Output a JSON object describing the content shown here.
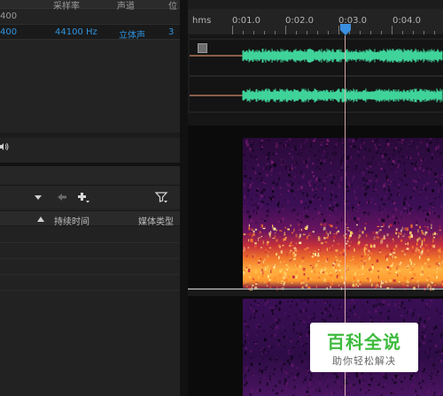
{
  "files_panel": {
    "columns": [
      {
        "label": "采样率"
      },
      {
        "label": "声道"
      },
      {
        "label": "位"
      }
    ],
    "partial_row_value": "400",
    "selected_file": {
      "duration": "400",
      "sample_rate": "44100 Hz",
      "channels": "立体声",
      "bit": "3"
    }
  },
  "media_panel": {
    "columns": [
      {
        "label": "持续时间"
      },
      {
        "label": "媒体类型"
      }
    ]
  },
  "editor": {
    "ruler_unit": "hms",
    "ruler_labels": [
      "0:01.0",
      "0:02.0",
      "0:03.0",
      "0:04.0"
    ]
  },
  "watermark": {
    "title": "百科全说",
    "subtitle": "助你轻松解决"
  },
  "colors": {
    "waveform": "#3fd39a",
    "selected_text": "#2f94e0",
    "playhead": "#3a8fe0"
  }
}
